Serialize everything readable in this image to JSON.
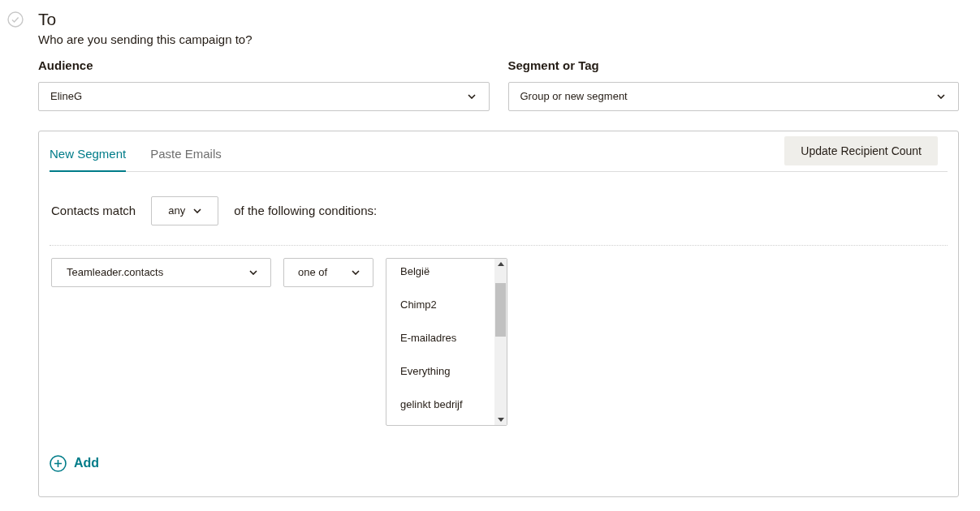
{
  "section": {
    "title": "To",
    "subtitle": "Who are you sending this campaign to?",
    "completed": false
  },
  "fields": [
    {
      "label": "Audience",
      "value": "ElineG"
    },
    {
      "label": "Segment or Tag",
      "value": "Group or new segment"
    }
  ],
  "panel": {
    "tabs": [
      {
        "label": "New Segment",
        "selected": true
      },
      {
        "label": "Paste Emails",
        "selected": false
      }
    ],
    "update_button": "Update Recipient Count",
    "match": {
      "prefix": "Contacts match",
      "value": "any",
      "suffix": "of the following conditions:"
    },
    "condition": {
      "field": "Teamleader.contacts",
      "operator": "one of",
      "options": [
        "België",
        "Chimp2",
        "E-mailadres",
        "Everything",
        "gelinkt bedrijf"
      ]
    },
    "add_button": "Add"
  }
}
